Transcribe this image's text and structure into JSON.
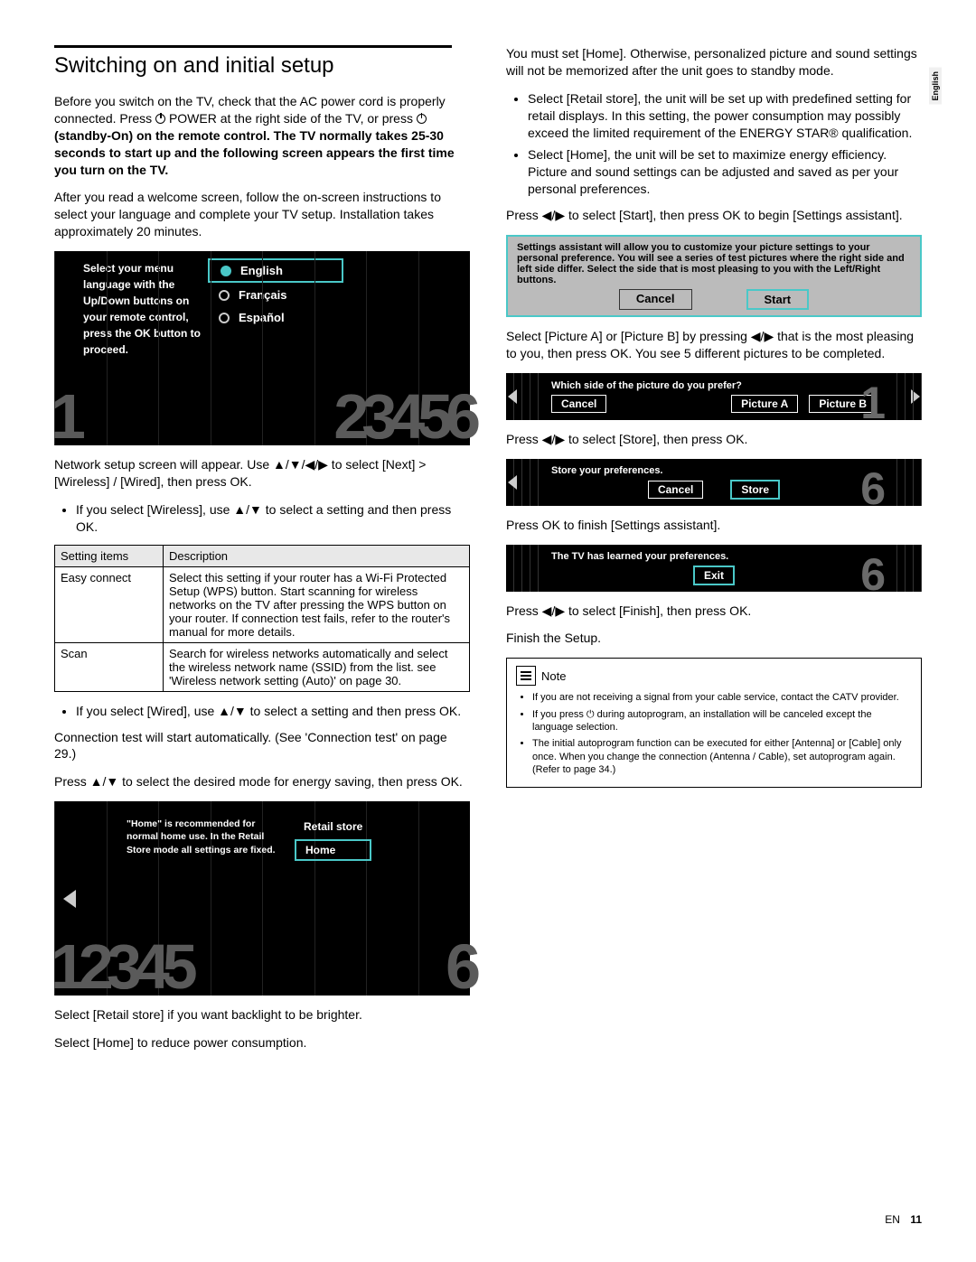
{
  "side_tab": "English",
  "heading": "Switching on and initial setup",
  "p1a": "Before you switch on the TV, check that the AC power cord is properly connected. Press ",
  "p1b": " POWER at the right side of the TV, or press ",
  "p1c": " (standby-On) on the remote control. The TV normally takes 25-30 seconds to start up and the following screen appears the first time you turn on the TV.",
  "p2": "After you read a welcome screen, follow the on-screen instructions to select your language and complete your TV setup. Installation takes approximately 20 minutes.",
  "osd_lang": {
    "prompt": "Select your menu language with the Up/Down buttons on your remote control, press the OK button to proceed.",
    "opts": [
      "English",
      "Français",
      "Español"
    ],
    "nums_left": "1",
    "nums_right": "23456"
  },
  "p3": "Network setup screen will appear. Use ▲/▼/◀/▶ to select [Next] > [Wireless] / [Wired], then press OK.",
  "li_wireless": "If you select [Wireless], use ▲/▼ to select a setting and then press OK.",
  "table": {
    "headers": [
      "Setting items",
      "Description"
    ],
    "rows": [
      [
        "Easy connect",
        "Select this setting if your router has a Wi-Fi Protected Setup (WPS) button. Start scanning for wireless networks on the TV after pressing the WPS button on your router. If connection test fails, refer to the router's manual for more details."
      ],
      [
        "Scan",
        "Search for wireless networks automatically and select the wireless network name (SSID) from the list. see 'Wireless network setting (Auto)' on page 30."
      ]
    ]
  },
  "li_wired": "If you select [Wired], use ▲/▼ to select a setting and then press OK.",
  "p4": "Connection test will start automatically. (See 'Connection test' on page 29.)",
  "p5": "Press ▲/▼ to select the desired mode for energy saving, then press OK.",
  "osd_mode": {
    "desc": "\"Home\" is recommended for normal home use. In the Retail Store mode all settings are fixed.",
    "opts": [
      "Retail store",
      "Home"
    ],
    "nums_left": "12345",
    "nums_right": "6"
  },
  "p6": "Select [Retail store] if you want backlight to be brighter.",
  "p7": "Select [Home] to reduce power consumption.",
  "r1": "You must set [Home]. Otherwise, personalized picture and sound settings will not be memorized after the unit goes to standby mode.",
  "r_li1": "Select [Retail store], the unit will be set up with predefined setting for retail displays. In this setting, the power consumption may possibly exceed the limited requirement of the ENERGY STAR® qualification.",
  "r_li2": "Select [Home], the unit will be set to maximize energy efficiency. Picture and sound settings can be adjusted and saved as per your personal preferences.",
  "r2": "Press ◀/▶ to select [Start], then press OK to begin [Settings assistant].",
  "gray": {
    "text": "Settings assistant will allow you to customize your picture settings to your personal preference. You will see a series of test pictures where the right side and left side differ. Select the side that is most pleasing to you with the Left/Right buttons.",
    "cancel": "Cancel",
    "start": "Start"
  },
  "r3": "Select [Picture A] or [Picture B] by pressing ◀/▶ that is the most pleasing to you, then press OK. You see 5 different pictures to be completed.",
  "osd_pic": {
    "title": "Which side of the picture do you prefer?",
    "cancel": "Cancel",
    "a": "Picture A",
    "b": "Picture B",
    "num": "1"
  },
  "r4": "Press ◀/▶ to select [Store], then press OK.",
  "osd_store": {
    "title": "Store your preferences.",
    "cancel": "Cancel",
    "store": "Store",
    "num": "6"
  },
  "r5": "Press OK to finish [Settings assistant].",
  "osd_exit": {
    "title": "The TV has learned your preferences.",
    "exit": "Exit",
    "num": "6"
  },
  "r6": "Press ◀/▶ to select [Finish], then press OK.",
  "r7": "Finish the Setup.",
  "note": {
    "label": "Note",
    "items": [
      "If you are not receiving a signal from your cable service, contact the CATV provider.",
      "If you press ⏻ during autoprogram, an installation will be canceled except the language selection.",
      "The initial autoprogram function can be executed for either [Antenna] or [Cable] only once. When you change the connection (Antenna / Cable), set autoprogram again. (Refer to page 34.)"
    ]
  },
  "footer": {
    "lang": "EN",
    "page": "11"
  }
}
